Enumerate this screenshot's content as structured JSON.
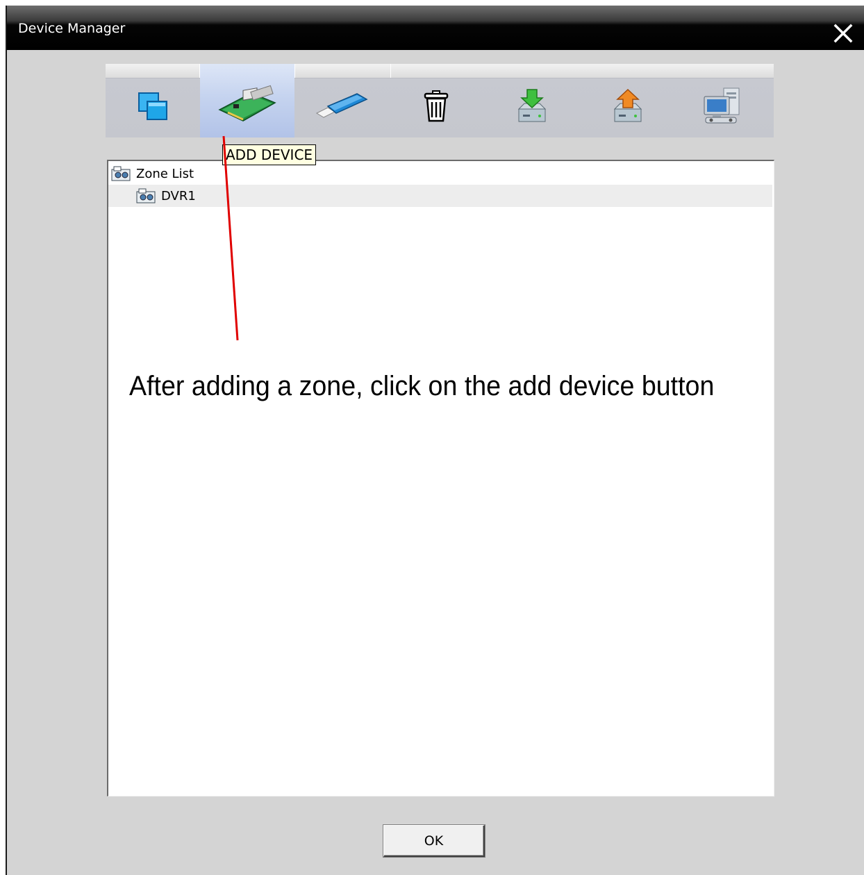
{
  "window": {
    "title": "Device Manager",
    "close_icon": "close-icon"
  },
  "toolbar": {
    "buttons": [
      {
        "name": "add-zone",
        "icon": "add-zone-icon"
      },
      {
        "name": "add-device",
        "icon": "pci-card-icon",
        "active": true
      },
      {
        "name": "modify",
        "icon": "usb-stick-icon"
      },
      {
        "name": "delete",
        "icon": "trash-icon"
      },
      {
        "name": "import",
        "icon": "download-drive-icon"
      },
      {
        "name": "export",
        "icon": "upload-drive-icon"
      },
      {
        "name": "network",
        "icon": "networked-computers-icon"
      }
    ],
    "tooltip": "ADD DEVICE"
  },
  "tree": {
    "root_label": "Zone List",
    "children": [
      {
        "label": "DVR1"
      }
    ]
  },
  "annotation": {
    "text": "After adding a zone, click on the add device button",
    "color": "#e00000"
  },
  "footer": {
    "ok_label": "OK"
  }
}
